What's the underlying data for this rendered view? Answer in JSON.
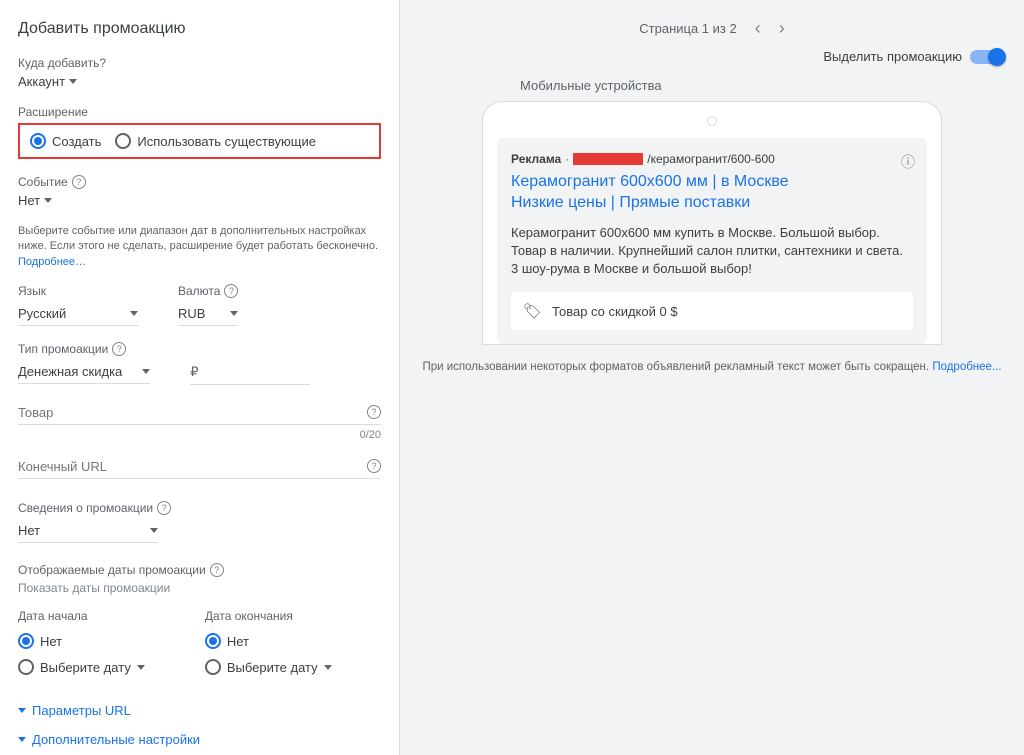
{
  "left": {
    "title": "Добавить промоакцию",
    "add_to_label": "Куда добавить?",
    "add_to_value": "Аккаунт",
    "extension_label": "Расширение",
    "create_label": "Создать",
    "use_existing_label": "Использовать существующие",
    "event_label": "Событие",
    "event_value": "Нет",
    "event_hint": "Выберите событие или диапазон дат в дополнительных настройках ниже. Если этого не сделать, расширение будет работать бесконечно. ",
    "event_hint_link": "Подробнее…",
    "language_label": "Язык",
    "language_value": "Русский",
    "currency_label": "Валюта",
    "currency_value": "RUB",
    "promo_type_label": "Тип промоакции",
    "promo_type_value": "Денежная скидка",
    "currency_symbol": "₽",
    "product_label": "Товар",
    "product_counter": "0/20",
    "final_url_label": "Конечный URL",
    "promo_details_label": "Сведения о промоакции",
    "promo_details_value": "Нет",
    "display_dates_label": "Отображаемые даты промоакции",
    "display_dates_hint": "Показать даты промоакции",
    "start_date_label": "Дата начала",
    "end_date_label": "Дата окончания",
    "date_none": "Нет",
    "date_select": "Выберите дату",
    "url_params_link": "Параметры URL",
    "more_settings_link": "Дополнительные настройки"
  },
  "right": {
    "pager": "Страница 1 из 2",
    "highlight_label": "Выделить промоакцию",
    "preview_label": "Мобильные устройства",
    "ad_badge": "Реклама",
    "ad_path": "/керамогранит/600-600",
    "ad_title1": "Керамогранит 600х600 мм | в Москве",
    "ad_title2": "Низкие цены | Прямые поставки",
    "ad_desc": "Керамогранит 600х600 мм купить в Москве. Большой выбор. Товар в наличии. Крупнейший салон плитки, сантехники и света. 3 шоу-рума в Москве и большой выбор!",
    "ad_promo_text": "Товар со скидкой 0 $",
    "footer_note": "При использовании некоторых форматов объявлений рекламный текст может быть сокращен. ",
    "footer_link": "Подробнее..."
  }
}
